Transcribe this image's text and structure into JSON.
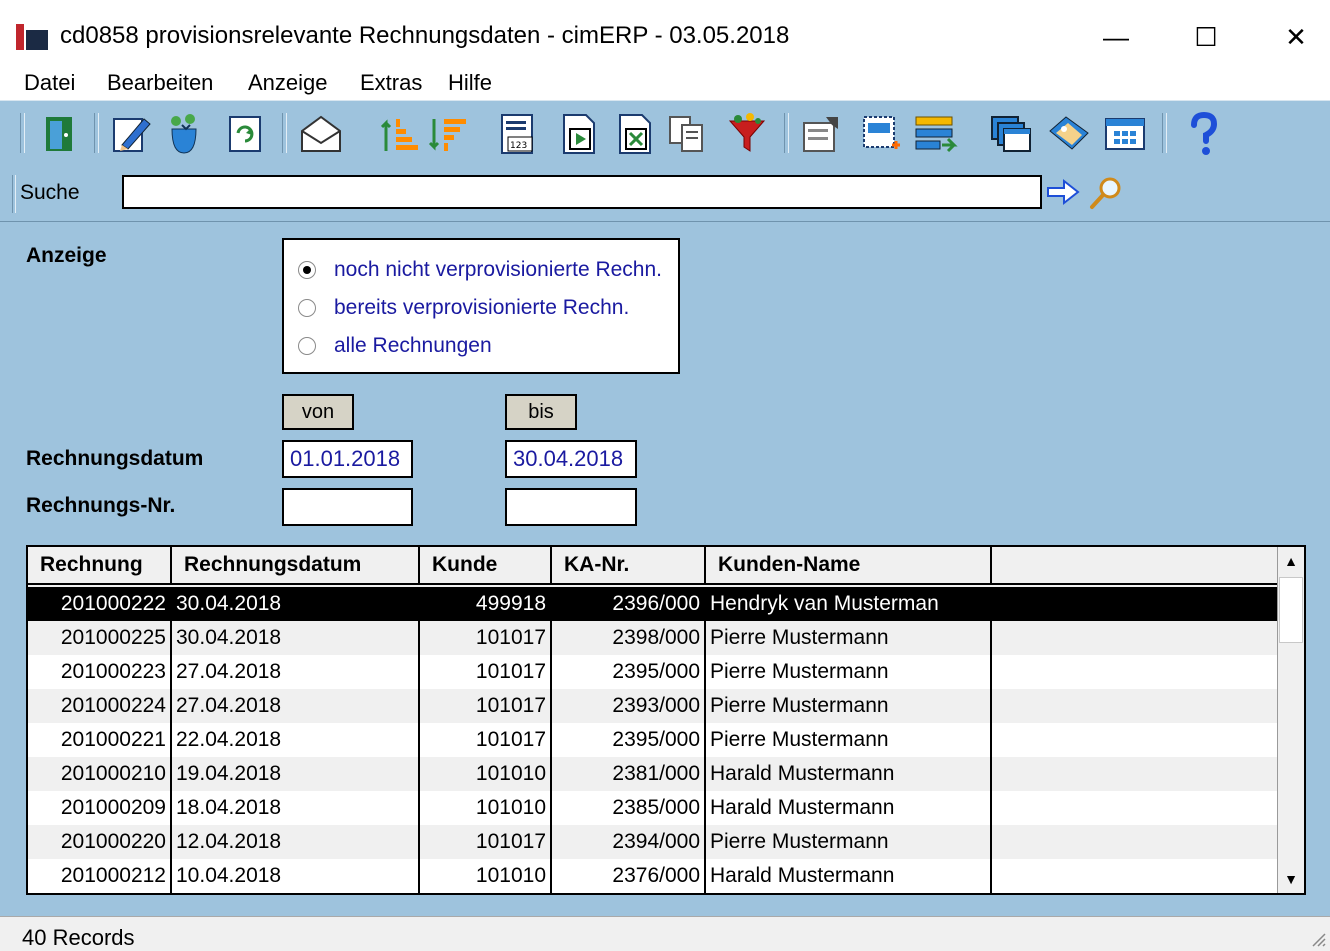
{
  "window": {
    "title": "cd0858 provisionsrelevante Rechnungsdaten - cimERP - 03.05.2018",
    "minimize_icon": "minimize-icon",
    "maximize_icon": "maximize-icon",
    "close_icon": "close-icon",
    "minimize": "—",
    "maximize": "☐",
    "close": "✕"
  },
  "menu": {
    "items": [
      "Datei",
      "Bearbeiten",
      "Anzeige",
      "Extras",
      "Hilfe"
    ]
  },
  "toolbar": {
    "icons": [
      "exit-door-icon",
      "edit-pencil-icon",
      "refresh-recycle-icon",
      "reload-document-icon",
      "mail-envelope-icon",
      "sort-ascending-icon",
      "sort-descending-icon",
      "number-format-icon",
      "export-pdf-icon",
      "export-excel-icon",
      "copy-documents-icon",
      "filter-funnel-icon",
      "properties-icon",
      "new-selection-icon",
      "layout-icon",
      "windows-icon",
      "tag-icon",
      "table-settings-icon",
      "help-icon"
    ]
  },
  "search": {
    "label": "Suche",
    "value": "",
    "go_icon": "arrow-right-icon",
    "lookup_icon": "magnifier-icon"
  },
  "filter": {
    "anzeige_label": "Anzeige",
    "options": [
      {
        "label": "noch nicht verprovisionierte Rechn.",
        "checked": true
      },
      {
        "label": "bereits verprovisionierte Rechn.",
        "checked": false
      },
      {
        "label": "alle Rechnungen",
        "checked": false
      }
    ],
    "von_label": "von",
    "bis_label": "bis",
    "rechnungsdatum_label": "Rechnungsdatum",
    "rechnungsnr_label": "Rechnungs-Nr.",
    "date_from": "01.01.2018",
    "date_to": "30.04.2018",
    "nr_from": "",
    "nr_to": ""
  },
  "table": {
    "columns": [
      "Rechnung",
      "Rechnungsdatum",
      "Kunde",
      "KA-Nr.",
      "Kunden-Name",
      ""
    ],
    "rows": [
      [
        "201000222",
        "30.04.2018",
        "499918",
        "2396/000",
        "Hendryk van Musterman"
      ],
      [
        "201000225",
        "30.04.2018",
        "101017",
        "2398/000",
        "Pierre Mustermann"
      ],
      [
        "201000223",
        "27.04.2018",
        "101017",
        "2395/000",
        "Pierre Mustermann"
      ],
      [
        "201000224",
        "27.04.2018",
        "101017",
        "2393/000",
        "Pierre Mustermann"
      ],
      [
        "201000221",
        "22.04.2018",
        "101017",
        "2395/000",
        "Pierre Mustermann"
      ],
      [
        "201000210",
        "19.04.2018",
        "101010",
        "2381/000",
        "Harald  Mustermann"
      ],
      [
        "201000209",
        "18.04.2018",
        "101010",
        "2385/000",
        "Harald  Mustermann"
      ],
      [
        "201000220",
        "12.04.2018",
        "101017",
        "2394/000",
        "Pierre Mustermann"
      ],
      [
        "201000212",
        "10.04.2018",
        "101010",
        "2376/000",
        "Harald  Mustermann"
      ]
    ],
    "selected_row": 0
  },
  "status": {
    "records": "40 Records"
  },
  "colors": {
    "background": "#9ec3dd",
    "selection": "#000000",
    "link_text": "#1a1aa0"
  }
}
